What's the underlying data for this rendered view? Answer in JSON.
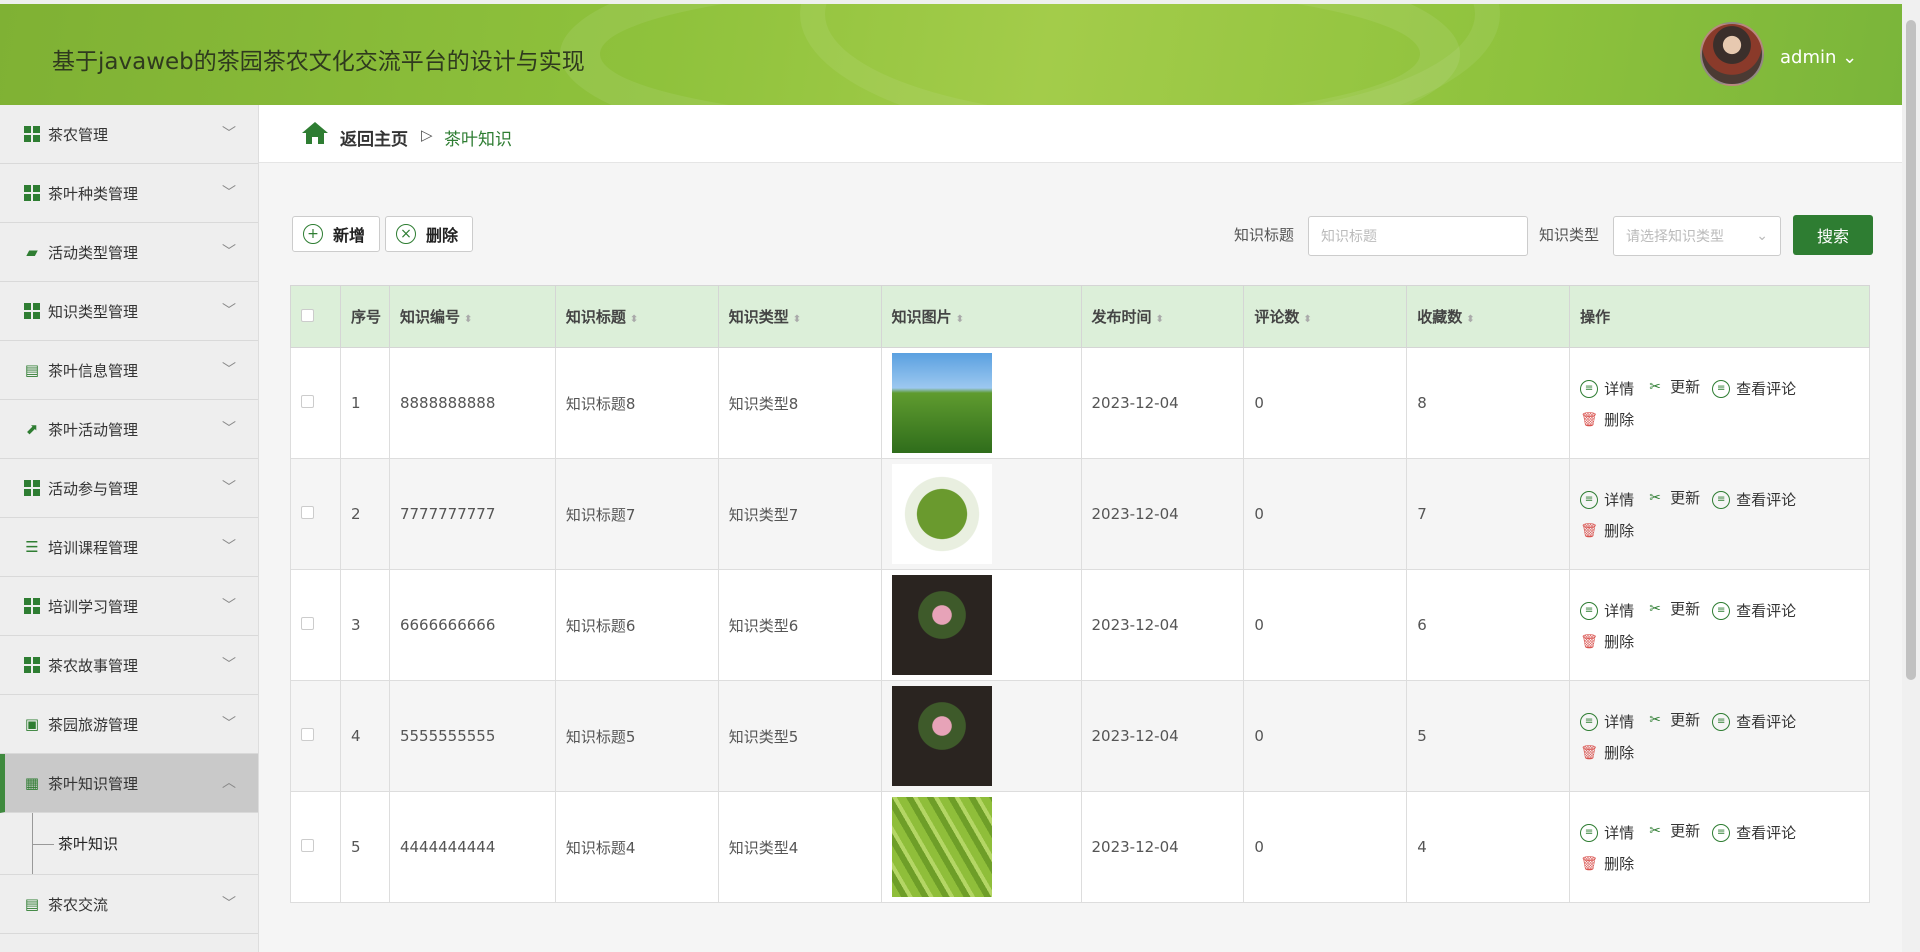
{
  "header": {
    "title": "基于javaweb的茶园茶农文化交流平台的设计与实现",
    "user": "admin ⌄"
  },
  "sidebar": {
    "items": [
      {
        "label": "茶农管理",
        "icon": "grid-icon"
      },
      {
        "label": "茶叶种类管理",
        "icon": "grid-icon"
      },
      {
        "label": "活动类型管理",
        "icon": "ticket-icon"
      },
      {
        "label": "知识类型管理",
        "icon": "grid-icon"
      },
      {
        "label": "茶叶信息管理",
        "icon": "chat-icon"
      },
      {
        "label": "茶叶活动管理",
        "icon": "chart-icon"
      },
      {
        "label": "活动参与管理",
        "icon": "grid-icon"
      },
      {
        "label": "培训课程管理",
        "icon": "list-icon"
      },
      {
        "label": "培训学习管理",
        "icon": "grid-icon"
      },
      {
        "label": "茶农故事管理",
        "icon": "grid-icon"
      },
      {
        "label": "茶园旅游管理",
        "icon": "wallet-icon"
      },
      {
        "label": "茶叶知识管理",
        "icon": "clipboard-x-icon"
      }
    ],
    "sub_item": "茶叶知识",
    "last_item": {
      "label": "茶农交流",
      "icon": "clipboard-icon"
    }
  },
  "breadcrumb": {
    "home": "返回主页",
    "separator": "▷",
    "current": "茶叶知识"
  },
  "toolbar": {
    "add": "新增",
    "delete": "删除"
  },
  "search": {
    "title_label": "知识标题",
    "title_placeholder": "知识标题",
    "type_label": "知识类型",
    "type_placeholder": "请选择知识类型",
    "button": "搜索"
  },
  "table": {
    "headers": [
      "序号",
      "知识编号",
      "知识标题",
      "知识类型",
      "知识图片",
      "发布时间",
      "评论数",
      "收藏数",
      "操作"
    ],
    "rows": [
      {
        "no": "1",
        "code": "8888888888",
        "title": "知识标题8",
        "type": "知识类型8",
        "date": "2023-12-04",
        "comments": "0",
        "favs": "8"
      },
      {
        "no": "2",
        "code": "7777777777",
        "title": "知识标题7",
        "type": "知识类型7",
        "date": "2023-12-04",
        "comments": "0",
        "favs": "7"
      },
      {
        "no": "3",
        "code": "6666666666",
        "title": "知识标题6",
        "type": "知识类型6",
        "date": "2023-12-04",
        "comments": "0",
        "favs": "6"
      },
      {
        "no": "4",
        "code": "5555555555",
        "title": "知识标题5",
        "type": "知识类型5",
        "date": "2023-12-04",
        "comments": "0",
        "favs": "5"
      },
      {
        "no": "5",
        "code": "4444444444",
        "title": "知识标题4",
        "type": "知识类型4",
        "date": "2023-12-04",
        "comments": "0",
        "favs": "4"
      }
    ],
    "actions": {
      "detail": "详情",
      "update": "更新",
      "comments": "查看评论",
      "delete": "删除"
    }
  },
  "colors": {
    "accent": "#2e7d32",
    "header_bg": "#8fc23c",
    "table_header_bg": "#dcefd9"
  }
}
